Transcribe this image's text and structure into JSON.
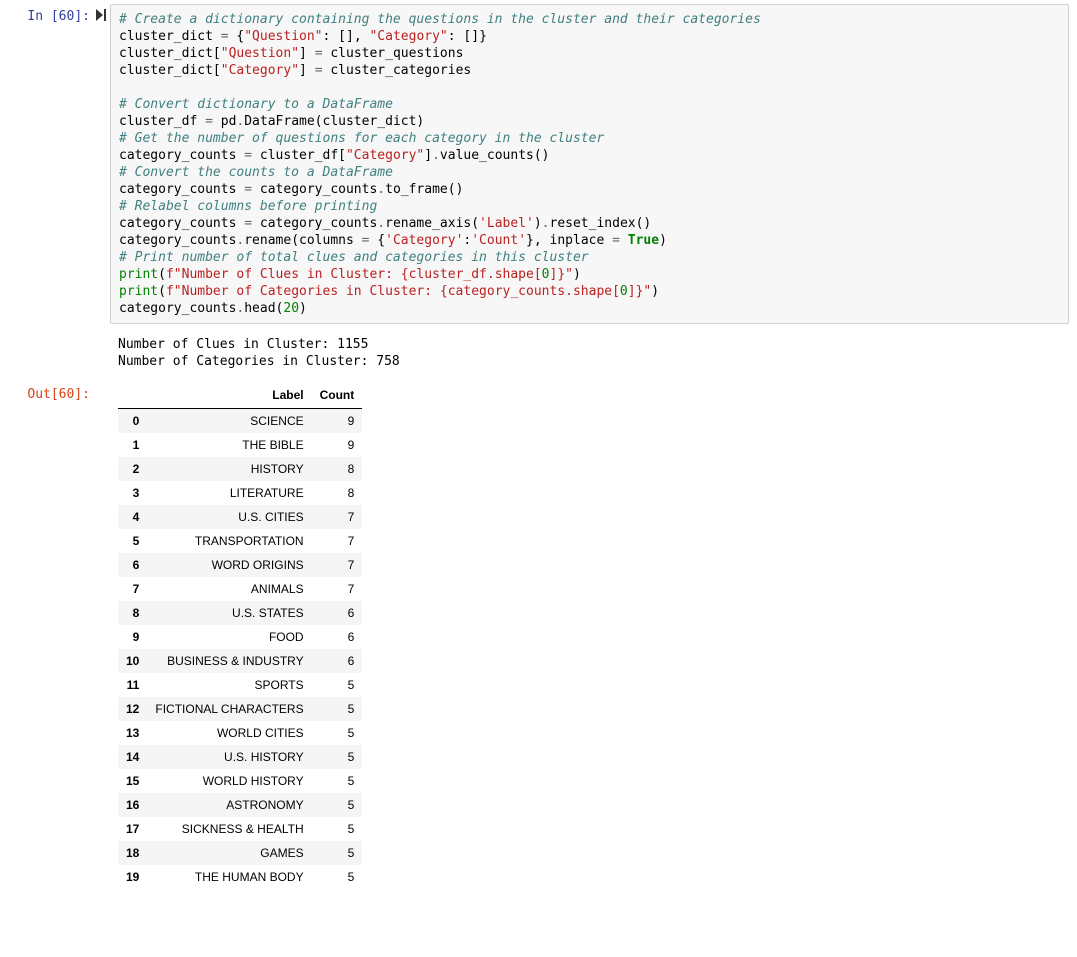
{
  "cell": {
    "in_prompt": "In [60]:",
    "out_prompt": "Out[60]:",
    "run_icon": "▶|",
    "code_tokens": [
      {
        "t": "# Create a dictionary containing the questions in the cluster and their categories",
        "cls": "c"
      },
      {
        "t": "\n"
      },
      {
        "t": "cluster_dict "
      },
      {
        "t": "=",
        "cls": "op"
      },
      {
        "t": " {"
      },
      {
        "t": "\"Question\"",
        "cls": "s"
      },
      {
        "t": ": [], "
      },
      {
        "t": "\"Category\"",
        "cls": "s"
      },
      {
        "t": ": []}"
      },
      {
        "t": "\n"
      },
      {
        "t": "cluster_dict["
      },
      {
        "t": "\"Question\"",
        "cls": "s"
      },
      {
        "t": "] "
      },
      {
        "t": "=",
        "cls": "op"
      },
      {
        "t": " cluster_questions"
      },
      {
        "t": "\n"
      },
      {
        "t": "cluster_dict["
      },
      {
        "t": "\"Category\"",
        "cls": "s"
      },
      {
        "t": "] "
      },
      {
        "t": "=",
        "cls": "op"
      },
      {
        "t": " cluster_categories"
      },
      {
        "t": "\n"
      },
      {
        "t": "\n"
      },
      {
        "t": "# Convert dictionary to a DataFrame",
        "cls": "c"
      },
      {
        "t": "\n"
      },
      {
        "t": "cluster_df "
      },
      {
        "t": "=",
        "cls": "op"
      },
      {
        "t": " pd"
      },
      {
        "t": ".",
        "cls": "op"
      },
      {
        "t": "DataFrame(cluster_dict)"
      },
      {
        "t": "\n"
      },
      {
        "t": "# Get the number of questions for each category in the cluster",
        "cls": "c"
      },
      {
        "t": "\n"
      },
      {
        "t": "category_counts "
      },
      {
        "t": "=",
        "cls": "op"
      },
      {
        "t": " cluster_df["
      },
      {
        "t": "\"Category\"",
        "cls": "s"
      },
      {
        "t": "]"
      },
      {
        "t": ".",
        "cls": "op"
      },
      {
        "t": "value_counts()"
      },
      {
        "t": "\n"
      },
      {
        "t": "# Convert the counts to a DataFrame",
        "cls": "c"
      },
      {
        "t": "\n"
      },
      {
        "t": "category_counts "
      },
      {
        "t": "=",
        "cls": "op"
      },
      {
        "t": " category_counts"
      },
      {
        "t": ".",
        "cls": "op"
      },
      {
        "t": "to_frame()"
      },
      {
        "t": "\n"
      },
      {
        "t": "# Relabel columns before printing",
        "cls": "c"
      },
      {
        "t": "\n"
      },
      {
        "t": "category_counts "
      },
      {
        "t": "=",
        "cls": "op"
      },
      {
        "t": " category_counts"
      },
      {
        "t": ".",
        "cls": "op"
      },
      {
        "t": "rename_axis("
      },
      {
        "t": "'Label'",
        "cls": "s"
      },
      {
        "t": ")"
      },
      {
        "t": ".",
        "cls": "op"
      },
      {
        "t": "reset_index()"
      },
      {
        "t": "\n"
      },
      {
        "t": "category_counts"
      },
      {
        "t": ".",
        "cls": "op"
      },
      {
        "t": "rename(columns "
      },
      {
        "t": "=",
        "cls": "op"
      },
      {
        "t": " {"
      },
      {
        "t": "'Category'",
        "cls": "s"
      },
      {
        "t": ":"
      },
      {
        "t": "'Count'",
        "cls": "s"
      },
      {
        "t": "}, inplace "
      },
      {
        "t": "=",
        "cls": "op"
      },
      {
        "t": " "
      },
      {
        "t": "True",
        "cls": "kw"
      },
      {
        "t": ")"
      },
      {
        "t": "\n"
      },
      {
        "t": "# Print number of total clues and categories in this cluster",
        "cls": "c"
      },
      {
        "t": "\n"
      },
      {
        "t": "print",
        "cls": "nb"
      },
      {
        "t": "("
      },
      {
        "t": "f\"Number of Clues in Cluster: ",
        "cls": "s"
      },
      {
        "t": "{cluster_df.shape[",
        "cls": "s"
      },
      {
        "t": "0",
        "cls": "nm"
      },
      {
        "t": "]}",
        "cls": "s"
      },
      {
        "t": "\"",
        "cls": "s"
      },
      {
        "t": ")"
      },
      {
        "t": "\n"
      },
      {
        "t": "print",
        "cls": "nb"
      },
      {
        "t": "("
      },
      {
        "t": "f\"Number of Categories in Cluster: ",
        "cls": "s"
      },
      {
        "t": "{category_counts.shape[",
        "cls": "s"
      },
      {
        "t": "0",
        "cls": "nm"
      },
      {
        "t": "]}",
        "cls": "s"
      },
      {
        "t": "\"",
        "cls": "s"
      },
      {
        "t": ")"
      },
      {
        "t": "\n"
      },
      {
        "t": "category_counts"
      },
      {
        "t": ".",
        "cls": "op"
      },
      {
        "t": "head("
      },
      {
        "t": "20",
        "cls": "nm"
      },
      {
        "t": ")"
      }
    ],
    "stdout": "Number of Clues in Cluster: 1155\nNumber of Categories in Cluster: 758",
    "table": {
      "columns": [
        "",
        "Label",
        "Count"
      ],
      "rows": [
        [
          "0",
          "SCIENCE",
          "9"
        ],
        [
          "1",
          "THE BIBLE",
          "9"
        ],
        [
          "2",
          "HISTORY",
          "8"
        ],
        [
          "3",
          "LITERATURE",
          "8"
        ],
        [
          "4",
          "U.S. CITIES",
          "7"
        ],
        [
          "5",
          "TRANSPORTATION",
          "7"
        ],
        [
          "6",
          "WORD ORIGINS",
          "7"
        ],
        [
          "7",
          "ANIMALS",
          "7"
        ],
        [
          "8",
          "U.S. STATES",
          "6"
        ],
        [
          "9",
          "FOOD",
          "6"
        ],
        [
          "10",
          "BUSINESS & INDUSTRY",
          "6"
        ],
        [
          "11",
          "SPORTS",
          "5"
        ],
        [
          "12",
          "FICTIONAL CHARACTERS",
          "5"
        ],
        [
          "13",
          "WORLD CITIES",
          "5"
        ],
        [
          "14",
          "U.S. HISTORY",
          "5"
        ],
        [
          "15",
          "WORLD HISTORY",
          "5"
        ],
        [
          "16",
          "ASTRONOMY",
          "5"
        ],
        [
          "17",
          "SICKNESS & HEALTH",
          "5"
        ],
        [
          "18",
          "GAMES",
          "5"
        ],
        [
          "19",
          "THE HUMAN BODY",
          "5"
        ]
      ]
    }
  }
}
